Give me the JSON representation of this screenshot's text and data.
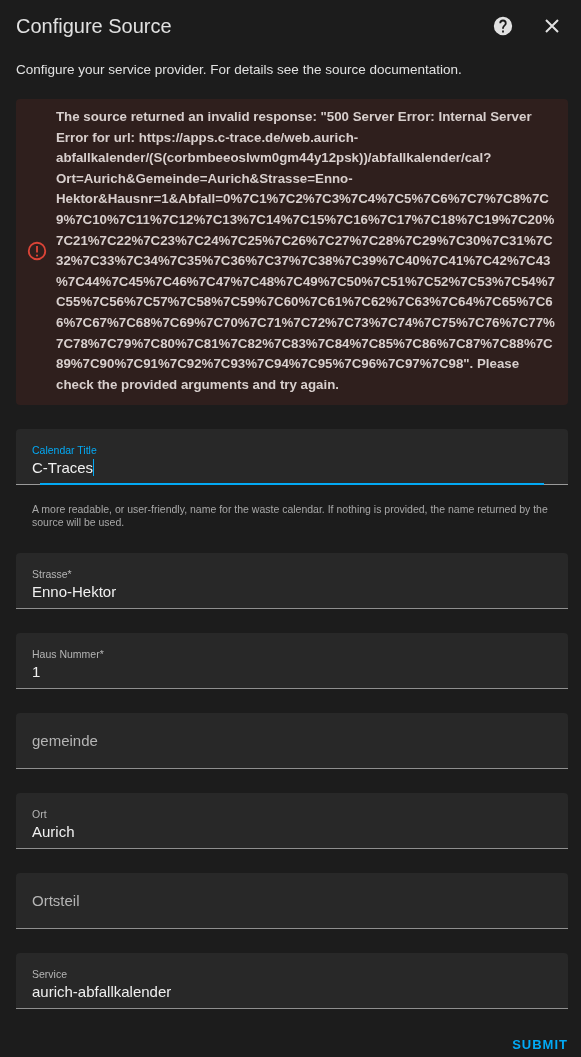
{
  "dialog": {
    "title": "Configure Source",
    "description": "Configure your service provider. For details see the source documentation."
  },
  "error": {
    "message": "The source returned an invalid response: \"500 Server Error: Internal Server Error for url: https://apps.c-trace.de/web.aurich-abfallkalender/(S(corbmbeeoslwm0gm44y12psk))/abfallkalender/cal?Ort=Aurich&Gemeinde=Aurich&Strasse=Enno-Hektor&Hausnr=1&Abfall=0%7C1%7C2%7C3%7C4%7C5%7C6%7C7%7C8%7C9%7C10%7C11%7C12%7C13%7C14%7C15%7C16%7C17%7C18%7C19%7C20%7C21%7C22%7C23%7C24%7C25%7C26%7C27%7C28%7C29%7C30%7C31%7C32%7C33%7C34%7C35%7C36%7C37%7C38%7C39%7C40%7C41%7C42%7C43%7C44%7C45%7C46%7C47%7C48%7C49%7C50%7C51%7C52%7C53%7C54%7C55%7C56%7C57%7C58%7C59%7C60%7C61%7C62%7C63%7C64%7C65%7C66%7C67%7C68%7C69%7C70%7C71%7C72%7C73%7C74%7C75%7C76%7C77%7C78%7C79%7C80%7C81%7C82%7C83%7C84%7C85%7C86%7C87%7C88%7C89%7C90%7C91%7C92%7C93%7C94%7C95%7C96%7C97%7C98\". Please check the provided arguments and try again."
  },
  "fields": [
    {
      "label": "Calendar Title",
      "value": "C-Traces",
      "focused": true,
      "helper": "A more readable, or user-friendly, name for the waste calendar. If nothing is provided, the name returned by the source will be used."
    },
    {
      "label": "Strasse*",
      "value": "Enno-Hektor",
      "focused": false
    },
    {
      "label": "Haus Nummer*",
      "value": "1",
      "focused": false
    },
    {
      "label": "gemeinde",
      "focused": false
    },
    {
      "label": "Ort",
      "value": "Aurich",
      "focused": false
    },
    {
      "label": "Ortsteil",
      "focused": false
    },
    {
      "label": "Service",
      "value": "aurich-abfallkalender",
      "focused": false
    }
  ],
  "submit": "SUBMIT"
}
